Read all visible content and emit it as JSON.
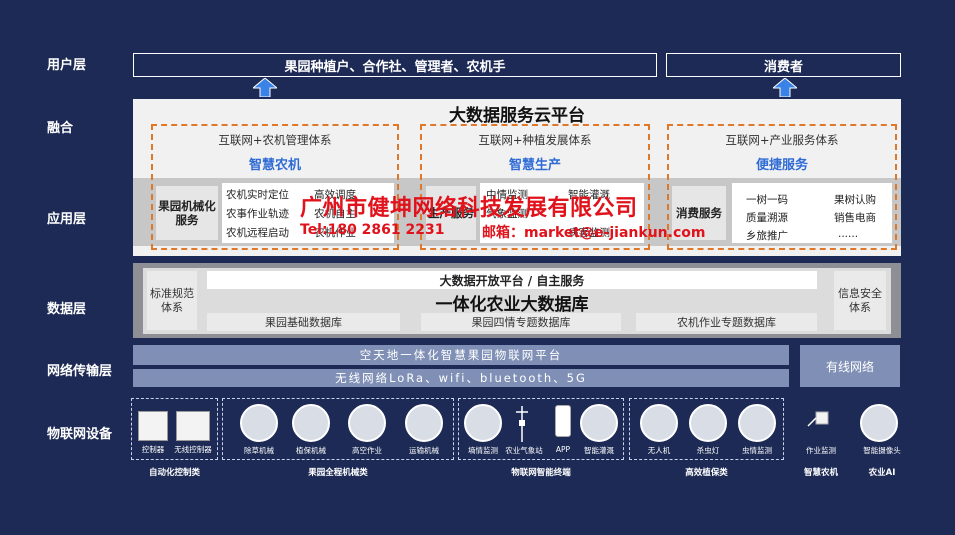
{
  "layers": {
    "user": "用户层",
    "fusion": "融合",
    "app": "应用层",
    "data": "数据层",
    "network": "网络传输层",
    "iot": "物联网设备"
  },
  "users": {
    "growers": "果园种植户、合作社、管理者、农机手",
    "consumers": "消费者"
  },
  "cloud": {
    "title": "大数据服务云平台",
    "pillars": [
      {
        "sub": "互联网+农机管理体系",
        "name": "智慧农机"
      },
      {
        "sub": "互联网+种植发展体系",
        "name": "智慧生产"
      },
      {
        "sub": "互联网+产业服务体系",
        "name": "便捷服务"
      }
    ],
    "services": {
      "machinery_head": "果园机械化服务",
      "machinery_items": [
        "农机实时定位",
        "农事作业轨迹",
        "农机远程启动",
        "高效调度",
        "农机自主",
        "农机作业"
      ],
      "production_head": "生产服务",
      "production_items": [
        "中情监测",
        "智能灌溉",
        "气象监测",
        "病害监测"
      ],
      "service_head": "消费服务",
      "service_items": [
        "一树一码",
        "果树认购",
        "质量溯源",
        "销售电商",
        "乡旅推广",
        "......"
      ]
    }
  },
  "data_layer": {
    "open_platform": "大数据开放平台  /  自主服务",
    "main": "一体化农业大数据库",
    "left": "标准规范体系",
    "right": "信息安全体系",
    "dbs": [
      "果园基础数据库",
      "果园四情专题数据库",
      "农机作业专题数据库"
    ]
  },
  "network": {
    "platform": "空天地一体化智慧果园物联网平台",
    "wireless": "无线网络LoRa、wifi、bluetooth、5G",
    "wired": "有线网络"
  },
  "iot": {
    "groups": [
      {
        "label": "自动化控制类",
        "devices": [
          "控制器",
          "无线控制器"
        ]
      },
      {
        "label": "果园全程机械类",
        "devices": [
          "除草机械",
          "植保机械",
          "高空作业",
          "运输机械"
        ]
      },
      {
        "label": "物联网智能终端",
        "devices": [
          "墒情监测",
          "农业气象站",
          "APP",
          "智能灌溉"
        ]
      },
      {
        "label": "高效植保类",
        "devices": [
          "无人机",
          "杀虫灯",
          "虫情监测"
        ]
      },
      {
        "label": "智慧农机",
        "devices": [
          "作业监测"
        ]
      },
      {
        "label": "农业AI",
        "devices": [
          "智能摄像头"
        ]
      }
    ]
  },
  "watermark": {
    "company": "广州市健坤网络科技发展有限公司",
    "tel": "Tel:180 2861 2231",
    "mail": "邮箱：market@e-jiankun.com"
  },
  "colors": {
    "background": "#1c2a55",
    "accent_blue": "#2f6bd6",
    "dashed_orange": "#e0782a",
    "watermark_red": "#e0121b",
    "arrow_blue": "#3b82e6"
  }
}
